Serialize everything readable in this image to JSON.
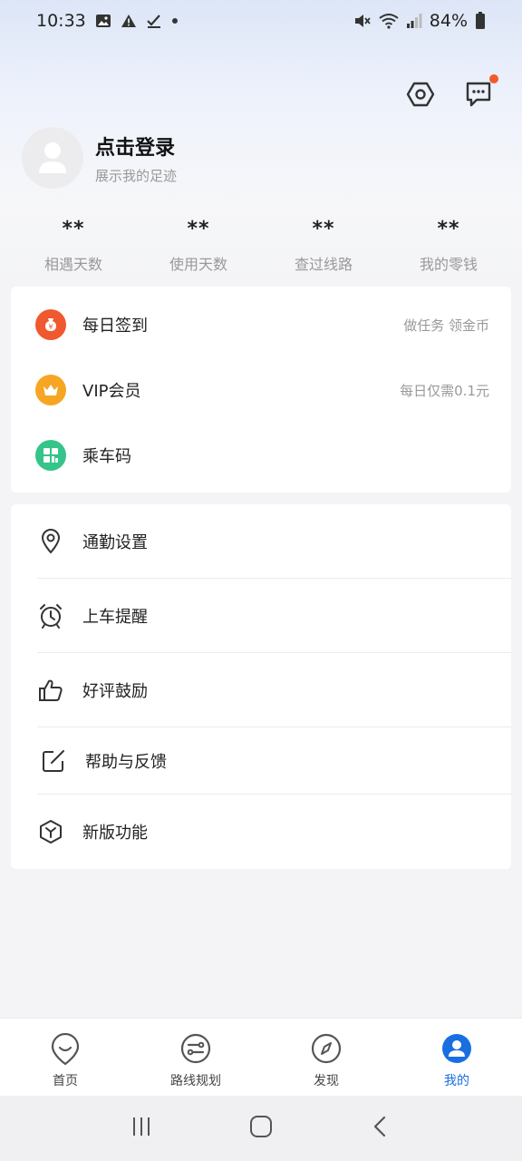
{
  "status_bar": {
    "time": "10:33",
    "battery": "84%"
  },
  "profile": {
    "title": "点击登录",
    "subtitle": "展示我的足迹"
  },
  "stats": [
    {
      "value": "**",
      "label": "相遇天数"
    },
    {
      "value": "**",
      "label": "使用天数"
    },
    {
      "value": "**",
      "label": "查过线路"
    },
    {
      "value": "**",
      "label": "我的零钱"
    }
  ],
  "feature_card": [
    {
      "label": "每日签到",
      "right": "做任务 领金币",
      "icon": "money-bag-icon",
      "color": "#f0582e"
    },
    {
      "label": "VIP会员",
      "right": "每日仅需0.1元",
      "icon": "crown-icon",
      "color": "#f6a623"
    },
    {
      "label": "乘车码",
      "right": "",
      "icon": "qr-code-icon",
      "color": "#35c48a"
    }
  ],
  "settings_card": [
    {
      "label": "通勤设置",
      "icon": "location-pin-icon"
    },
    {
      "label": "上车提醒",
      "icon": "alarm-clock-icon"
    },
    {
      "label": "好评鼓励",
      "icon": "thumbs-up-icon"
    },
    {
      "label": "帮助与反馈",
      "icon": "edit-icon"
    },
    {
      "label": "新版功能",
      "icon": "cube-icon"
    }
  ],
  "bottom_nav": [
    {
      "label": "首页",
      "icon": "home-smile-icon"
    },
    {
      "label": "路线规划",
      "icon": "route-icon"
    },
    {
      "label": "发现",
      "icon": "compass-icon"
    },
    {
      "label": "我的",
      "icon": "profile-icon",
      "active": true
    }
  ],
  "colors": {
    "accent": "#1a6fe0",
    "notification_dot": "#f25a2a"
  }
}
